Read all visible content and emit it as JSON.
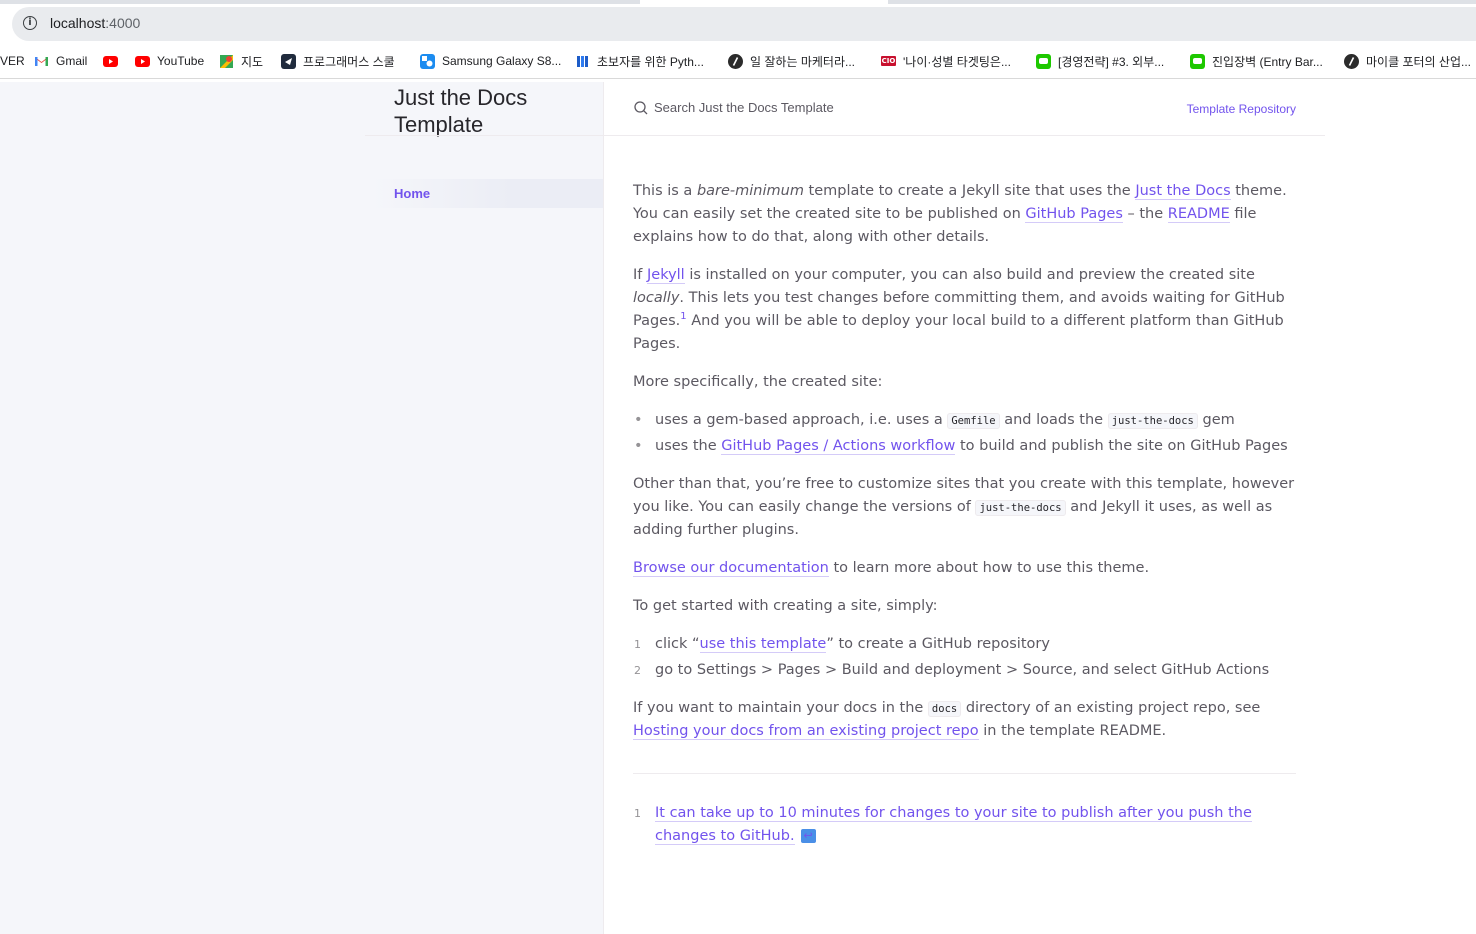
{
  "browser": {
    "url_host": "localhost",
    "url_port": ":4000",
    "bookmarks": [
      {
        "label": "VER",
        "icon": "naver-icon"
      },
      {
        "label": "Gmail",
        "icon": "gmail-icon"
      },
      {
        "label": "",
        "icon": "youtube-icon"
      },
      {
        "label": "YouTube",
        "icon": "youtube-icon"
      },
      {
        "label": "지도",
        "icon": "maps-icon"
      },
      {
        "label": "프로그래머스 스쿨",
        "icon": "programmers-icon"
      },
      {
        "label": "Samsung Galaxy S8...",
        "icon": "samsung-icon"
      },
      {
        "label": "초보자를 위한 Pyth...",
        "icon": "book-icon"
      },
      {
        "label": "일 잘하는 마케터라...",
        "icon": "slash-icon"
      },
      {
        "label": "'나이·성별 타겟팅은...",
        "icon": "cio-icon"
      },
      {
        "label": "[경영전략] #3. 외부...",
        "icon": "line-icon"
      },
      {
        "label": "진입장벽 (Entry Bar...",
        "icon": "line-icon"
      },
      {
        "label": "마이클 포터의 산업...",
        "icon": "slash-icon"
      }
    ]
  },
  "site": {
    "title": "Just the Docs Template",
    "nav": {
      "home": "Home"
    },
    "search_placeholder": "Search Just the Docs Template",
    "aux_link": "Template Repository"
  },
  "content": {
    "p1": {
      "a": "This is a ",
      "em": "bare-minimum",
      "b": " template to create a Jekyll site that uses the ",
      "link1": "Just the Docs",
      "c": " theme. You can easily set the created site to be published on ",
      "link2": "GitHub Pages",
      "d": " – the ",
      "link3": "README",
      "e": " file explains how to do that, along with other details."
    },
    "p2": {
      "a": "If ",
      "link1": "Jekyll",
      "b": " is installed on your computer, you can also build and preview the created site ",
      "em": "locally",
      "c": ". This lets you test changes before committing them, and avoids waiting for GitHub Pages.",
      "sup": "1",
      "d": " And you will be able to deploy your local build to a different platform than GitHub Pages."
    },
    "p3": "More specifically, the created site:",
    "list1": {
      "item1": {
        "a": "uses a gem-based approach, i.e. uses a ",
        "code1": "Gemfile",
        "b": " and loads the ",
        "code2": "just-the-docs",
        "c": " gem"
      },
      "item2": {
        "a": "uses the ",
        "link": "GitHub Pages / Actions workflow",
        "b": " to build and publish the site on GitHub Pages"
      }
    },
    "p4": {
      "a": "Other than that, you’re free to customize sites that you create with this template, however you like. You can easily change the versions of ",
      "code": "just-the-docs",
      "b": " and Jekyll it uses, as well as adding further plugins."
    },
    "p5": {
      "link": "Browse our documentation",
      "a": " to learn more about how to use this theme."
    },
    "p6": "To get started with creating a site, simply:",
    "list2": {
      "item1": {
        "num": "1",
        "a": "click “",
        "link": "use this template",
        "b": "” to create a GitHub repository"
      },
      "item2": {
        "num": "2",
        "a": "go to Settings > Pages > Build and deployment > Source, and select GitHub Actions"
      }
    },
    "p7": {
      "a": "If you want to maintain your docs in the ",
      "code": "docs",
      "b": " directory of an existing project repo, see ",
      "link": "Hosting your docs from an existing project repo",
      "c": " in the template README."
    },
    "footnote": {
      "num": "1",
      "link": "It can take up to 10 minutes for changes to your site to publish after you push the changes to GitHub.",
      "backref": "↩"
    }
  }
}
